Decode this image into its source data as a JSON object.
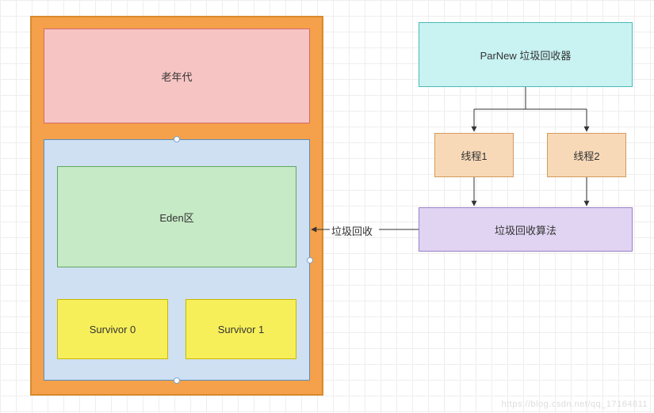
{
  "heap": {
    "old_gen": "老年代",
    "eden": "Eden区",
    "survivor0": "Survivor 0",
    "survivor1": "Survivor 1"
  },
  "gc": {
    "collector": "ParNew 垃圾回收器",
    "thread1": "线程1",
    "thread2": "线程2",
    "algorithm": "垃圾回收算法"
  },
  "edge": {
    "gc_to_heap": "垃圾回收"
  },
  "watermark": "https://blog.csdn.net/qq_17164811",
  "chart_data": {
    "type": "diagram",
    "title": "ParNew 垃圾回收器",
    "nodes": [
      {
        "id": "heap",
        "label": "",
        "children": [
          "old_gen",
          "young_gen"
        ]
      },
      {
        "id": "old_gen",
        "label": "老年代"
      },
      {
        "id": "young_gen",
        "label": "",
        "children": [
          "eden",
          "survivor0",
          "survivor1"
        ]
      },
      {
        "id": "eden",
        "label": "Eden区"
      },
      {
        "id": "survivor0",
        "label": "Survivor 0"
      },
      {
        "id": "survivor1",
        "label": "Survivor 1"
      },
      {
        "id": "parnew",
        "label": "ParNew 垃圾回收器"
      },
      {
        "id": "thread1",
        "label": "线程1"
      },
      {
        "id": "thread2",
        "label": "线程2"
      },
      {
        "id": "gc_algorithm",
        "label": "垃圾回收算法"
      }
    ],
    "edges": [
      {
        "from": "parnew",
        "to": "thread1"
      },
      {
        "from": "parnew",
        "to": "thread2"
      },
      {
        "from": "thread1",
        "to": "gc_algorithm"
      },
      {
        "from": "thread2",
        "to": "gc_algorithm"
      },
      {
        "from": "gc_algorithm",
        "to": "young_gen",
        "label": "垃圾回收"
      }
    ]
  }
}
